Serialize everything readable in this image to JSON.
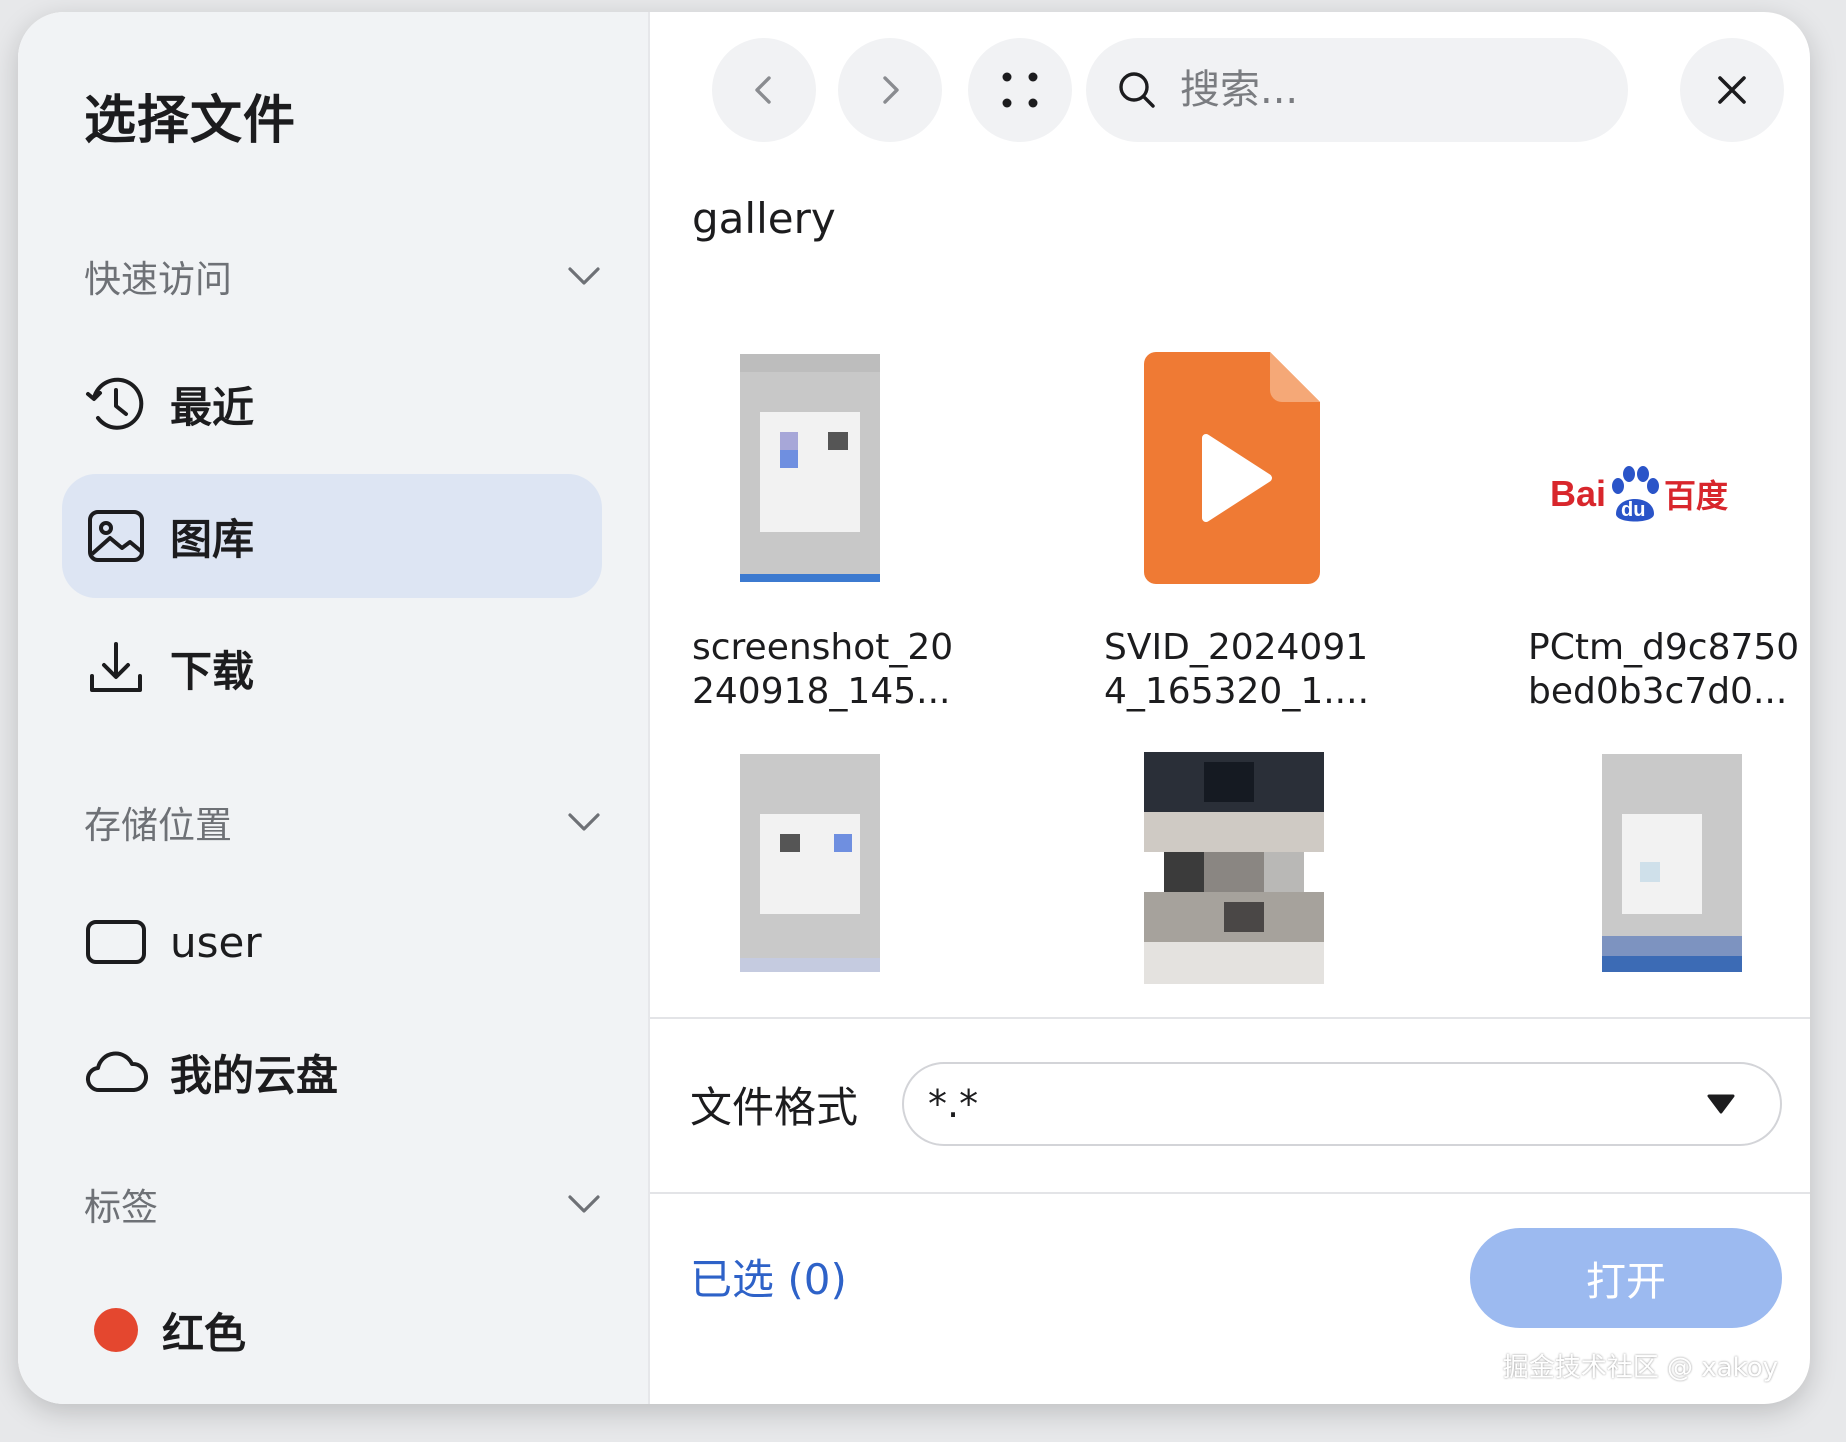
{
  "dialog": {
    "title": "选择文件"
  },
  "sidebar": {
    "quick_access": {
      "label": "快速访问",
      "items": [
        {
          "label": "最近",
          "icon": "clock-history-icon"
        },
        {
          "label": "图库",
          "icon": "image-icon",
          "selected": true
        },
        {
          "label": "下载",
          "icon": "download-icon"
        }
      ]
    },
    "storage": {
      "label": "存储位置",
      "items": [
        {
          "label": "user",
          "icon": "drive-icon"
        },
        {
          "label": "我的云盘",
          "icon": "cloud-icon"
        }
      ]
    },
    "tags": {
      "label": "标签",
      "items": [
        {
          "label": "红色",
          "color": "#e4472f"
        }
      ]
    }
  },
  "toolbar": {
    "search_placeholder": "搜索..."
  },
  "folder": {
    "name": "gallery"
  },
  "files": [
    {
      "name_line1": "screenshot_20",
      "name_line2": "240918_145...",
      "type": "image"
    },
    {
      "name_line1": "SVID_2024091",
      "name_line2": "4_165320_1....",
      "type": "video"
    },
    {
      "name_line1": "PCtm_d9c8750",
      "name_line2": "bed0b3c7d0...",
      "type": "image",
      "logo_text": "Bai",
      "logo_text_cn": "百度",
      "logo_paw": "du"
    },
    {
      "type": "image"
    },
    {
      "type": "image"
    },
    {
      "type": "image"
    }
  ],
  "format": {
    "label": "文件格式",
    "value": "*.*"
  },
  "footer": {
    "selected": "已选 (0)",
    "open_label": "打开"
  },
  "watermark": "掘金技术社区 @ xakoy",
  "colors": {
    "accent": "#2e62c8",
    "selected_bg": "#dde5f3",
    "open_button": "#9cbaf0",
    "video_orange": "#ef7a34"
  }
}
